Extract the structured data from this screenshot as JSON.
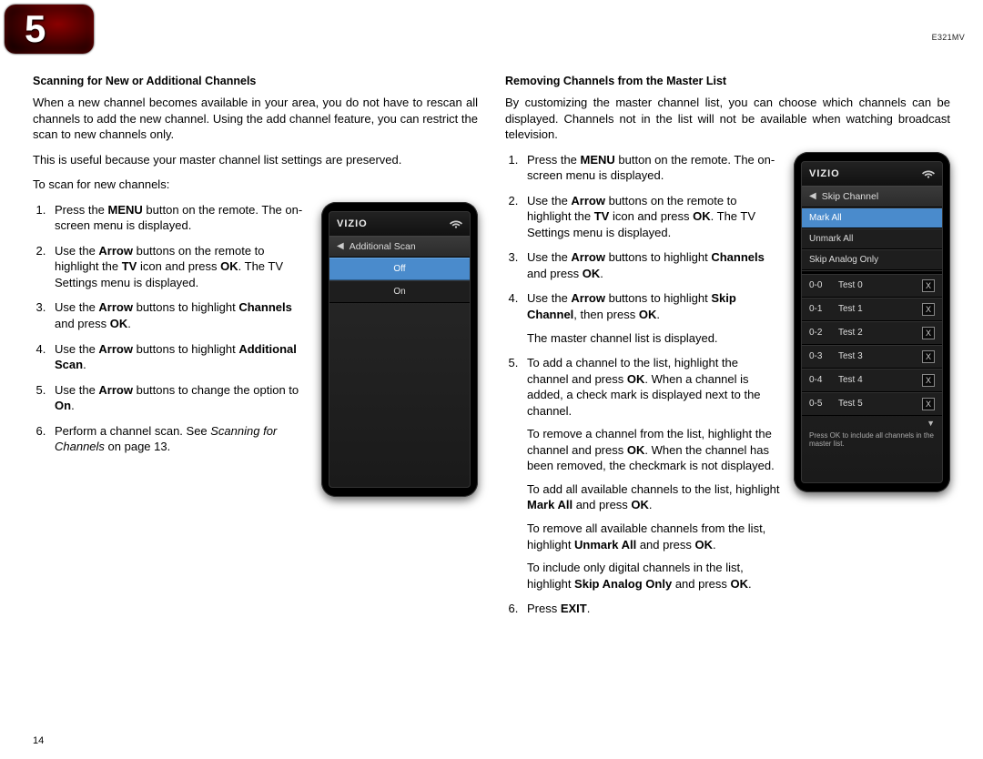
{
  "chapterNumber": "5",
  "modelCode": "E321MV",
  "pageNumber": "14",
  "left": {
    "heading": "Scanning for New or Additional Channels",
    "p1": "When a new channel becomes available in your area, you do not have to rescan all channels to add the new channel. Using the add channel feature, you can restrict the scan to new channels only.",
    "p2": "This is useful because your master channel list settings are preserved.",
    "lead": "To scan for new channels:",
    "s1a": "Press the ",
    "s1b": "MENU",
    "s1c": " button on the remote. The on-screen menu is displayed.",
    "s2a": "Use the ",
    "s2b": "Arrow",
    "s2c": " buttons on the remote to highlight the ",
    "s2d": "TV",
    "s2e": " icon and press ",
    "s2f": "OK",
    "s2g": ". The TV Settings menu is displayed.",
    "s3a": "Use the ",
    "s3b": "Arrow",
    "s3c": " buttons to highlight ",
    "s3d": "Channels",
    "s3e": " and press ",
    "s3f": "OK",
    "s3g": ".",
    "s4a": "Use the ",
    "s4b": "Arrow",
    "s4c": " buttons to highlight ",
    "s4d": "Additional Scan",
    "s4e": ".",
    "s5a": "Use the ",
    "s5b": "Arrow",
    "s5c": " buttons to change the option to ",
    "s5d": "On",
    "s5e": ".",
    "s6a": "Perform a channel scan. See ",
    "s6b": "Scanning for Channels",
    "s6c": " on page 13.",
    "phone": {
      "brand": "VIZIO",
      "crumb": "Additional Scan",
      "off": "Off",
      "on": "On"
    }
  },
  "right": {
    "heading": "Removing Channels from the Master List",
    "p1": "By customizing the master channel list, you can choose which channels can be displayed. Channels not in the list will not be available when watching broadcast television.",
    "s1a": "Press the ",
    "s1b": "MENU",
    "s1c": " button on the remote. The on-screen menu is displayed.",
    "s2a": "Use the ",
    "s2b": "Arrow",
    "s2c": " buttons on the remote to highlight the ",
    "s2d": "TV",
    "s2e": " icon and press ",
    "s2f": "OK",
    "s2g": ". The TV Settings menu is displayed.",
    "s3a": "Use the ",
    "s3b": "Arrow",
    "s3c": " buttons to highlight ",
    "s3d": "Channels",
    "s3e": " and press ",
    "s3f": "OK",
    "s3g": ".",
    "s4a": "Use the ",
    "s4b": "Arrow",
    "s4c": " buttons to highlight ",
    "s4d": "Skip Channel",
    "s4e": ", then press ",
    "s4f": "OK",
    "s4g": ".",
    "s4sub": "The master channel list is displayed.",
    "s5a": "To add a channel to the list, highlight the channel and press ",
    "s5b": "OK",
    "s5c": ". When a channel is added, a check mark is displayed next to the channel.",
    "s5subA1": "To remove a channel from the list, highlight the channel and press ",
    "s5subA2": "OK",
    "s5subA3": ". When the channel has been removed, the checkmark is not displayed.",
    "s5subB1": "To add all available channels to the list, highlight ",
    "s5subB2": "Mark All",
    "s5subB3": " and press ",
    "s5subB4": "OK",
    "s5subB5": ".",
    "s5subC1": "To remove all available channels from the list, highlight ",
    "s5subC2": "Unmark All",
    "s5subC3": " and press ",
    "s5subC4": "OK",
    "s5subC5": ".",
    "s5subD1": "To include only digital channels in the list, highlight ",
    "s5subD2": "Skip Analog Only",
    "s5subD3": " and press ",
    "s5subD4": "OK",
    "s5subD5": ".",
    "s6a": "Press ",
    "s6b": "EXIT",
    "s6c": ".",
    "phone": {
      "brand": "VIZIO",
      "crumb": "Skip Channel",
      "markAll": "Mark All",
      "unmarkAll": "Unmark All",
      "skipAnalog": "Skip Analog Only",
      "channels": [
        {
          "no": "0-0",
          "name": "Test 0"
        },
        {
          "no": "0-1",
          "name": "Test 1"
        },
        {
          "no": "0-2",
          "name": "Test 2"
        },
        {
          "no": "0-3",
          "name": "Test 3"
        },
        {
          "no": "0-4",
          "name": "Test 4"
        },
        {
          "no": "0-5",
          "name": "Test 5"
        }
      ],
      "note": "Press OK to include all channels in the master list."
    }
  }
}
